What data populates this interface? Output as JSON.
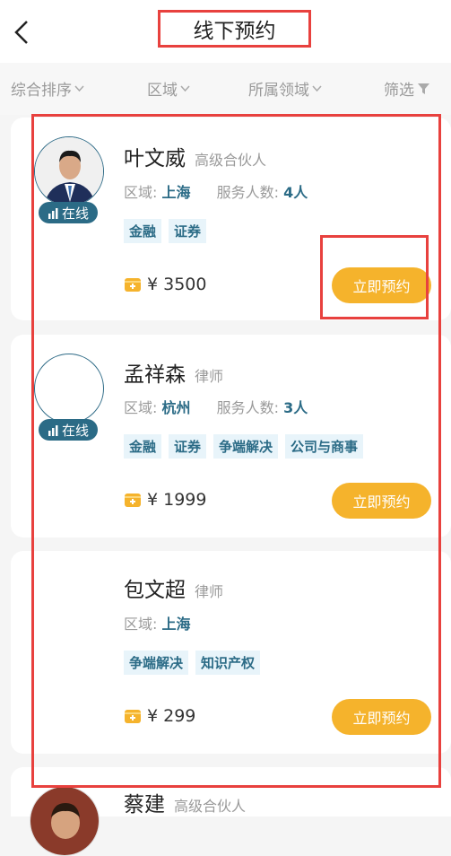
{
  "header": {
    "title": "线下预约"
  },
  "filters": [
    "综合排序",
    "区域",
    "所属领域",
    "筛选"
  ],
  "cards": [
    {
      "name": "叶文威",
      "role": "高级合伙人",
      "region_label": "区域:",
      "region": "上海",
      "served_label": "服务人数:",
      "served": "4人",
      "online": "在线",
      "tags": [
        "金融",
        "证券"
      ],
      "price": "¥ 3500",
      "button": "立即预约"
    },
    {
      "name": "孟祥森",
      "role": "律师",
      "region_label": "区域:",
      "region": "杭州",
      "served_label": "服务人数:",
      "served": "3人",
      "online": "在线",
      "tags": [
        "金融",
        "证券",
        "争端解决",
        "公司与商事"
      ],
      "price": "¥ 1999",
      "button": "立即预约"
    },
    {
      "name": "包文超",
      "role": "律师",
      "region_label": "区域:",
      "region": "上海",
      "tags": [
        "争端解决",
        "知识产权"
      ],
      "price": "¥ 299",
      "button": "立即预约"
    },
    {
      "name": "蔡建",
      "role": "高级合伙人"
    }
  ]
}
